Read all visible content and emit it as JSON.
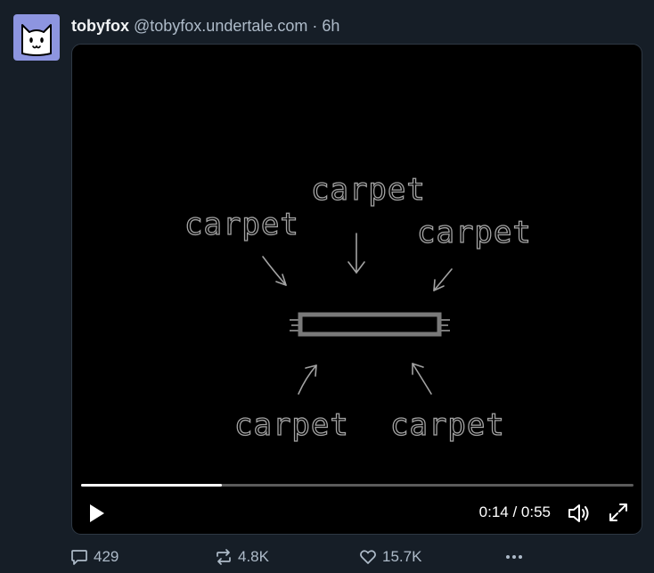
{
  "post": {
    "author": {
      "display_name": "tobyfox",
      "handle": "@tobyfox.undertale.com",
      "separator": "·",
      "time": "6h",
      "avatar_icon": "white-cat-face"
    },
    "video": {
      "drawing_labels": [
        "carpet",
        "carpet",
        "carpet",
        "carpet",
        "carpet"
      ],
      "progress_fraction": 0.255,
      "current_time": "0:14",
      "duration": "0:55",
      "time_readout": "0:14 / 0:55",
      "controls": {
        "play_icon": "play-icon",
        "volume_icon": "speaker-icon",
        "fullscreen_icon": "expand-icon"
      }
    },
    "actions": {
      "replies": "429",
      "reposts": "4.8K",
      "likes": "15.7K",
      "more_icon": "ellipsis-icon"
    }
  },
  "colors": {
    "background": "#161e27",
    "muted_text": "#aebbc9",
    "avatar_bg": "#8d95e0",
    "drawing_stroke": "#a3a3a3"
  }
}
